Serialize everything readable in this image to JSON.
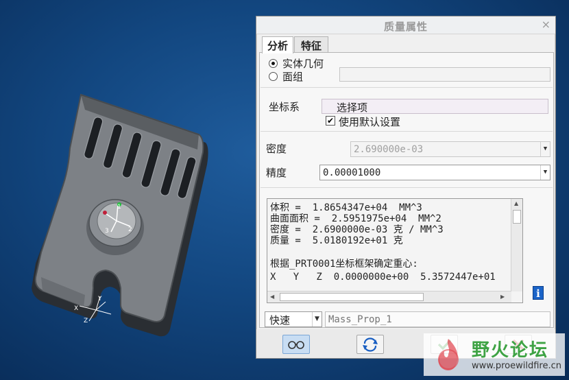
{
  "dialog": {
    "title": "质量属性",
    "close": "×",
    "tabs": [
      "分析",
      "特征"
    ],
    "geometry": {
      "solid_label": "实体几何",
      "quilt_label": "面组",
      "selected": "solid"
    },
    "csys": {
      "label": "坐标系",
      "select_label": "选择项",
      "use_default_label": "使用默认设置",
      "use_default_checked": true
    },
    "density": {
      "label": "密度",
      "value": "2.690000e-03"
    },
    "accuracy": {
      "label": "精度",
      "value": "0.00001000"
    },
    "results": {
      "lines": [
        "体积 =  1.8654347e+04  MM^3",
        "曲面面积 =  2.5951975e+04  MM^2",
        "密度 =  2.6900000e-03 克 / MM^3",
        "质量 =  5.0180192e+01 克",
        "",
        "根据_PRT0001坐标框架确定重心:",
        "X   Y   Z  0.0000000e+00  5.3572447e+01"
      ]
    },
    "mode": {
      "value": "快速",
      "name_placeholder": "Mass_Prop_1"
    }
  },
  "viewport": {
    "csys_labels": [
      "1",
      "2",
      "3",
      "X",
      "Y",
      "Z"
    ]
  },
  "watermark": {
    "text": "野火论坛",
    "url": "www.proewildfire.cn"
  },
  "colors": {
    "background": "#12467f",
    "ok_green": "#2e9b32",
    "cancel_red": "#c8282d",
    "info_blue": "#1b64c8"
  },
  "icons": {
    "preview": "glasses-icon",
    "repeat": "repeat-arrows-icon",
    "ok": "checkmark-icon",
    "cancel": "cross-icon",
    "info": "info-icon"
  }
}
